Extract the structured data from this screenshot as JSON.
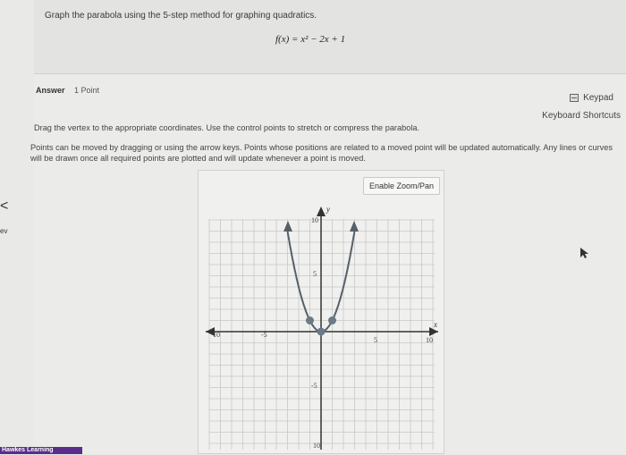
{
  "question": {
    "instruction": "Graph the parabola using the 5-step method for graphing quadratics.",
    "equation": "f(x) = x² − 2x + 1"
  },
  "answer": {
    "label": "Answer",
    "points": "1 Point",
    "keypad_label": "Keypad",
    "keypad_icon": "keypad-icon",
    "shortcuts_label": "Keyboard Shortcuts",
    "drag_instruction": "Drag the vertex to the appropriate coordinates. Use the control points to stretch or compress the parabola.",
    "points_note": "Points can be moved by dragging or using the arrow keys. Points whose positions are related to a moved point will be updated automatically. Any lines or curves will be drawn once all required points are plotted and will update whenever a point is moved."
  },
  "graph": {
    "zoom_button": "Enable Zoom/Pan",
    "x_label": "x",
    "y_label": "y",
    "ticks": {
      "x_neg10": "10",
      "x_neg5": "-5",
      "x_5": "5",
      "x_10": "10",
      "y_10": "10",
      "y_5": "5",
      "y_neg5": "-5",
      "y_neg10": "10"
    },
    "vertex": {
      "x": 0,
      "y": 0
    },
    "control_points": [
      {
        "x": -1,
        "y": 1
      },
      {
        "x": 1,
        "y": 1
      }
    ],
    "curve_color": "#556069",
    "point_color": "#6b7a86"
  },
  "nav": {
    "back_arrow": "<",
    "back_label": "ev"
  },
  "footer": {
    "brand": "Hawkes Learning",
    "brand_color": "#5a2d8a"
  }
}
